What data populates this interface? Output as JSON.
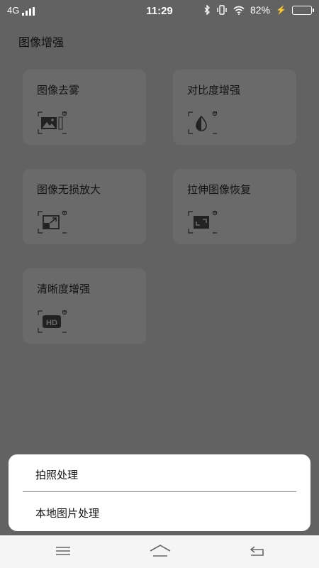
{
  "status_bar": {
    "network": "4G",
    "time": "11:29",
    "battery": "82%",
    "battery_level": 0.82
  },
  "page": {
    "title": "图像增强"
  },
  "cards": [
    {
      "title": "图像去雾",
      "icon": "image-landscape-icon"
    },
    {
      "title": "对比度增强",
      "icon": "contrast-icon"
    },
    {
      "title": "图像无损放大",
      "icon": "enlarge-icon"
    },
    {
      "title": "拉伸图像恢复",
      "icon": "stretch-restore-icon"
    },
    {
      "title": "清晰度增强",
      "icon": "hd-icon"
    }
  ],
  "sheet": {
    "items": [
      {
        "label": "拍照处理"
      },
      {
        "label": "本地图片处理"
      }
    ]
  },
  "navbar": {
    "icons": [
      "menu-icon",
      "home-icon",
      "back-icon"
    ]
  },
  "colors": {
    "dim_background": "#626262",
    "card_background": "#6a6a6a",
    "sheet_background": "#ffffff",
    "navbar_background": "#f5f5f5"
  }
}
